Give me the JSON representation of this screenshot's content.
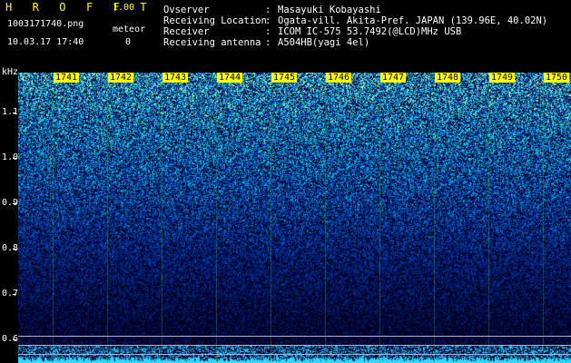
{
  "app": {
    "title": "H R O F F T",
    "version": "1.00",
    "filename": "1003171740.png",
    "datetime": "10.03.17 17:40",
    "meteor_label": "meteor",
    "meteor_count": "0"
  },
  "info": {
    "rows": [
      {
        "label": "Ovserver",
        "value": "Masayuki Kobayashi"
      },
      {
        "label": "Receiving Location",
        "value": "Ogata-vill. Akita-Pref. JAPAN (139.96E, 40.02N)"
      },
      {
        "label": "Receiver",
        "value": "ICOM IC-575 53.7492(@LCD)MHz USB"
      },
      {
        "label": "Receiving antenna",
        "value": "A504HB(yagi 4el)"
      }
    ]
  },
  "spectrogram": {
    "y_unit": "kHz",
    "y_ticks": [
      "1.1",
      "1.0",
      "0.9",
      "0.8",
      "0.7",
      "0.6"
    ],
    "time_labels": [
      "1741",
      "1742",
      "1743",
      "1744",
      "1745",
      "1746",
      "1747",
      "1748",
      "1749",
      "1750"
    ],
    "colors": {
      "label_bg": "#ffff00",
      "noise_low": "#0a0a6e",
      "noise_high": "#2ad6d6",
      "baseline": "#2fd8ff"
    }
  }
}
